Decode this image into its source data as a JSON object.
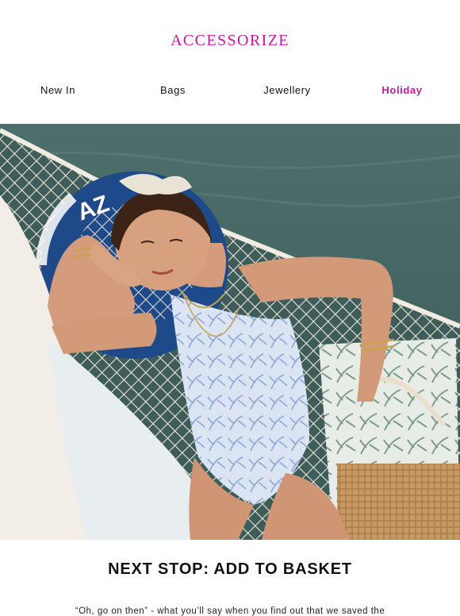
{
  "brand": {
    "logo_text": "ACCESSORIZE",
    "accent_color": "#c9179e"
  },
  "nav": {
    "items": [
      {
        "label": "New In",
        "active": false
      },
      {
        "label": "Bags",
        "active": false
      },
      {
        "label": "Jewellery",
        "active": false
      },
      {
        "label": "Holiday",
        "active": true
      }
    ]
  },
  "hero": {
    "ring_logo_text": "AZ"
  },
  "content": {
    "headline": "NEXT STOP: ADD TO BASKET",
    "body": "“Oh, go on then” - what you’ll say when you find out that we saved the"
  }
}
